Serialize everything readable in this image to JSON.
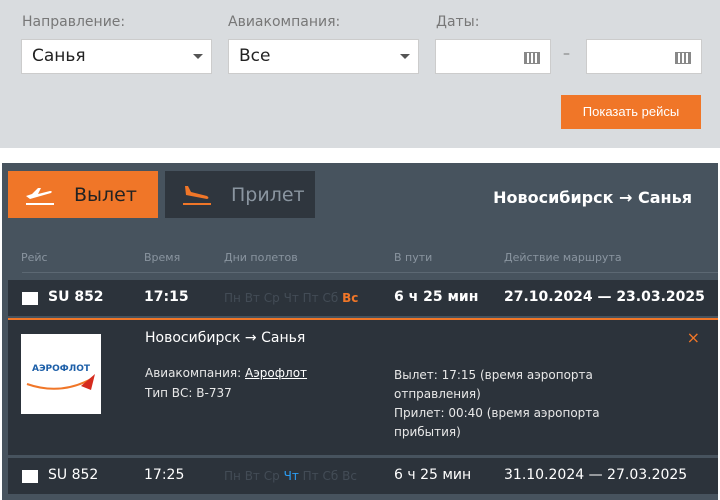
{
  "filters": {
    "direction_label": "Направление:",
    "direction_value": "Санья",
    "airline_label": "Авиакомпания:",
    "airline_value": "Все",
    "dates_label": "Даты:",
    "date_from": "",
    "date_to": "",
    "dash": "–",
    "show_button": "Показать рейсы"
  },
  "tabs": {
    "departure": "Вылет",
    "arrival": "Прилет",
    "active": "departure"
  },
  "route": "Новосибирск → Санья",
  "columns": [
    "Рейс",
    "Время",
    "Дни полетов",
    "В пути",
    "Действие маршрута"
  ],
  "days": [
    "Пн",
    "Вт",
    "Ср",
    "Чт",
    "Пт",
    "Сб",
    "Вс"
  ],
  "flights": [
    {
      "flight": "SU 852",
      "time": "17:15",
      "active_day": "Вс",
      "duration": "6 ч 25 мин",
      "period": "27.10.2024 — 23.03.2025"
    },
    {
      "flight": "SU 852",
      "time": "17:25",
      "active_day": "Чт",
      "duration": "6 ч 25 мин",
      "period": "31.10.2024 — 27.03.2025"
    }
  ],
  "details": {
    "route": "Новосибирск → Санья",
    "airline_label": "Авиакомпания:",
    "airline": "Аэрофлот",
    "aircraft": "Тип ВС: B-737",
    "departure": "Вылет: 17:15 (время аэропорта отправления)",
    "arrival": "Прилет: 00:40 (время аэропорта прибытия)",
    "logo_text": "АЭРОФЛОТ",
    "close": "×"
  },
  "colors": {
    "accent": "#f07628",
    "board": "#47535e",
    "row": "#2c333b",
    "active_day_1": "#f07628",
    "active_day_2": "#2a9df4"
  }
}
